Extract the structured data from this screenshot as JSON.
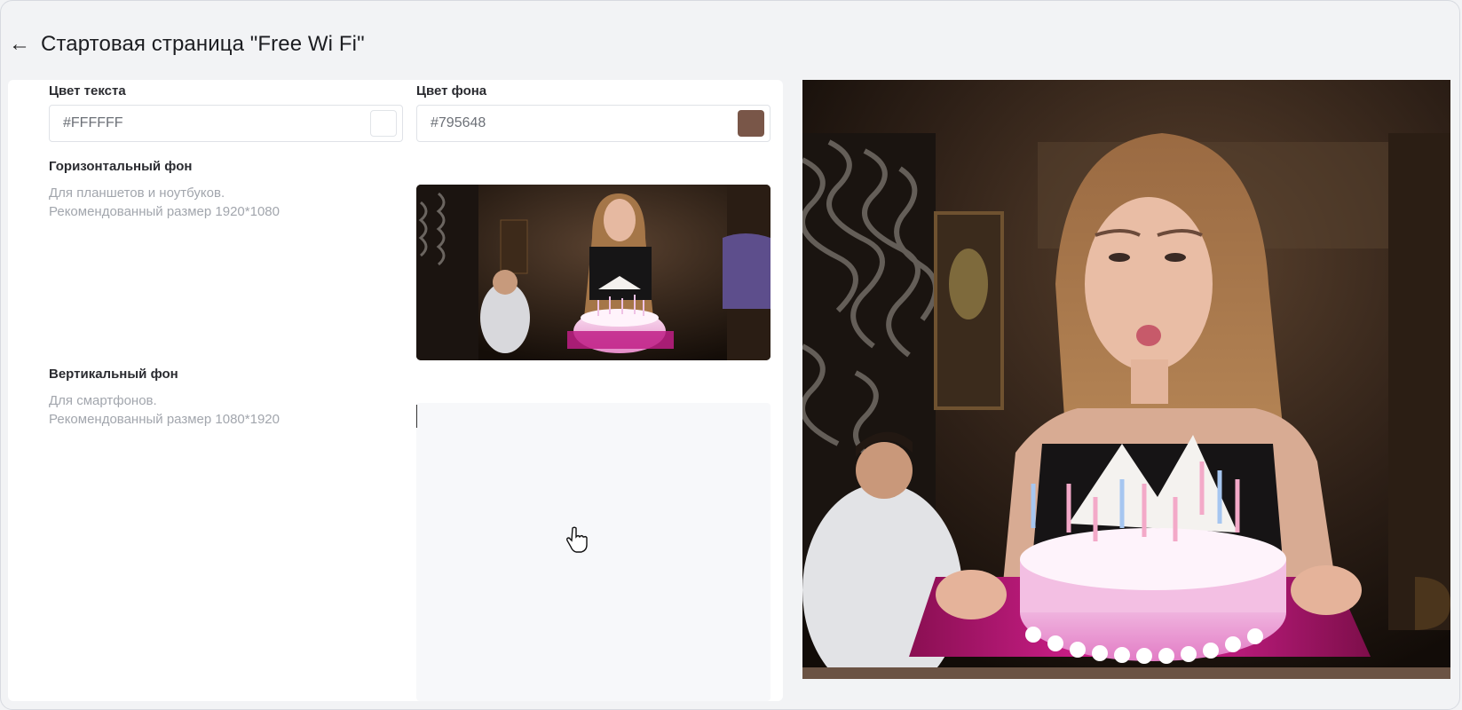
{
  "page": {
    "title": "Стартовая страница \"Free Wi Fi\""
  },
  "text_color": {
    "label": "Цвет текста",
    "value": "#FFFFFF",
    "swatch": "#FFFFFF"
  },
  "bg_color": {
    "label": "Цвет фона",
    "value": "#795648",
    "swatch": "#795648"
  },
  "horizontal": {
    "label": "Горизонтальный фон",
    "hint1": "Для планшетов и ноутбуков.",
    "hint2": "Рекомендованный размер 1920*1080"
  },
  "vertical": {
    "label": "Вертикальный фон",
    "hint1": "Для смартфонов.",
    "hint2": "Рекомендованный размер 1080*1920"
  },
  "icons": [
    "arrow-left-icon",
    "pointer-hand-icon"
  ]
}
